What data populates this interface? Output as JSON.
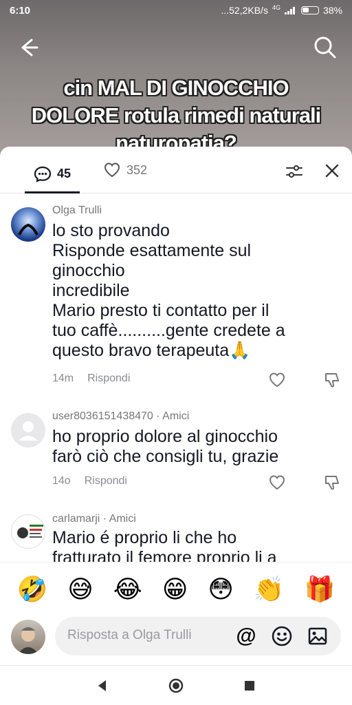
{
  "status": {
    "time": "6:10",
    "network": "...52,2KB/s",
    "net_type": "4G",
    "battery": "38%"
  },
  "video": {
    "caption": "cin MAL DI GINOCCHIO DOLORE rotula rimedi naturali naturopatia?"
  },
  "tabs": {
    "comments_count": "45",
    "likes_count": "352"
  },
  "comments": [
    {
      "user": "Olga Trulli",
      "lines": [
        "lo sto provando",
        "Risponde esattamente sul",
        "ginocchio",
        "incredibile",
        "Mario presto ti contatto per il",
        "tuo caffè..........gente credete a",
        "questo bravo terapeuta🙏"
      ],
      "time": "14m",
      "reply": "Rispondi"
    },
    {
      "user": "user8036151438470 · Amici",
      "lines": [
        "ho proprio dolore al ginocchio",
        "farò ciò che consigli tu, grazie"
      ],
      "time": "14o",
      "reply": "Rispondi"
    },
    {
      "user": "carlamarji · Amici",
      "lines": [
        "Mario é proprio li che ho",
        "fratturato il femore proprio li a"
      ],
      "time": "",
      "reply": ""
    }
  ],
  "emojis": [
    "🤣",
    "😅",
    "😂",
    "😁",
    "😳",
    "👏",
    "🎁"
  ],
  "input": {
    "placeholder": "Risposta a Olga Trulli",
    "at_symbol": "@"
  },
  "colors": {
    "text": "#161823",
    "muted": "#8a8b91",
    "accent": "#161823"
  }
}
